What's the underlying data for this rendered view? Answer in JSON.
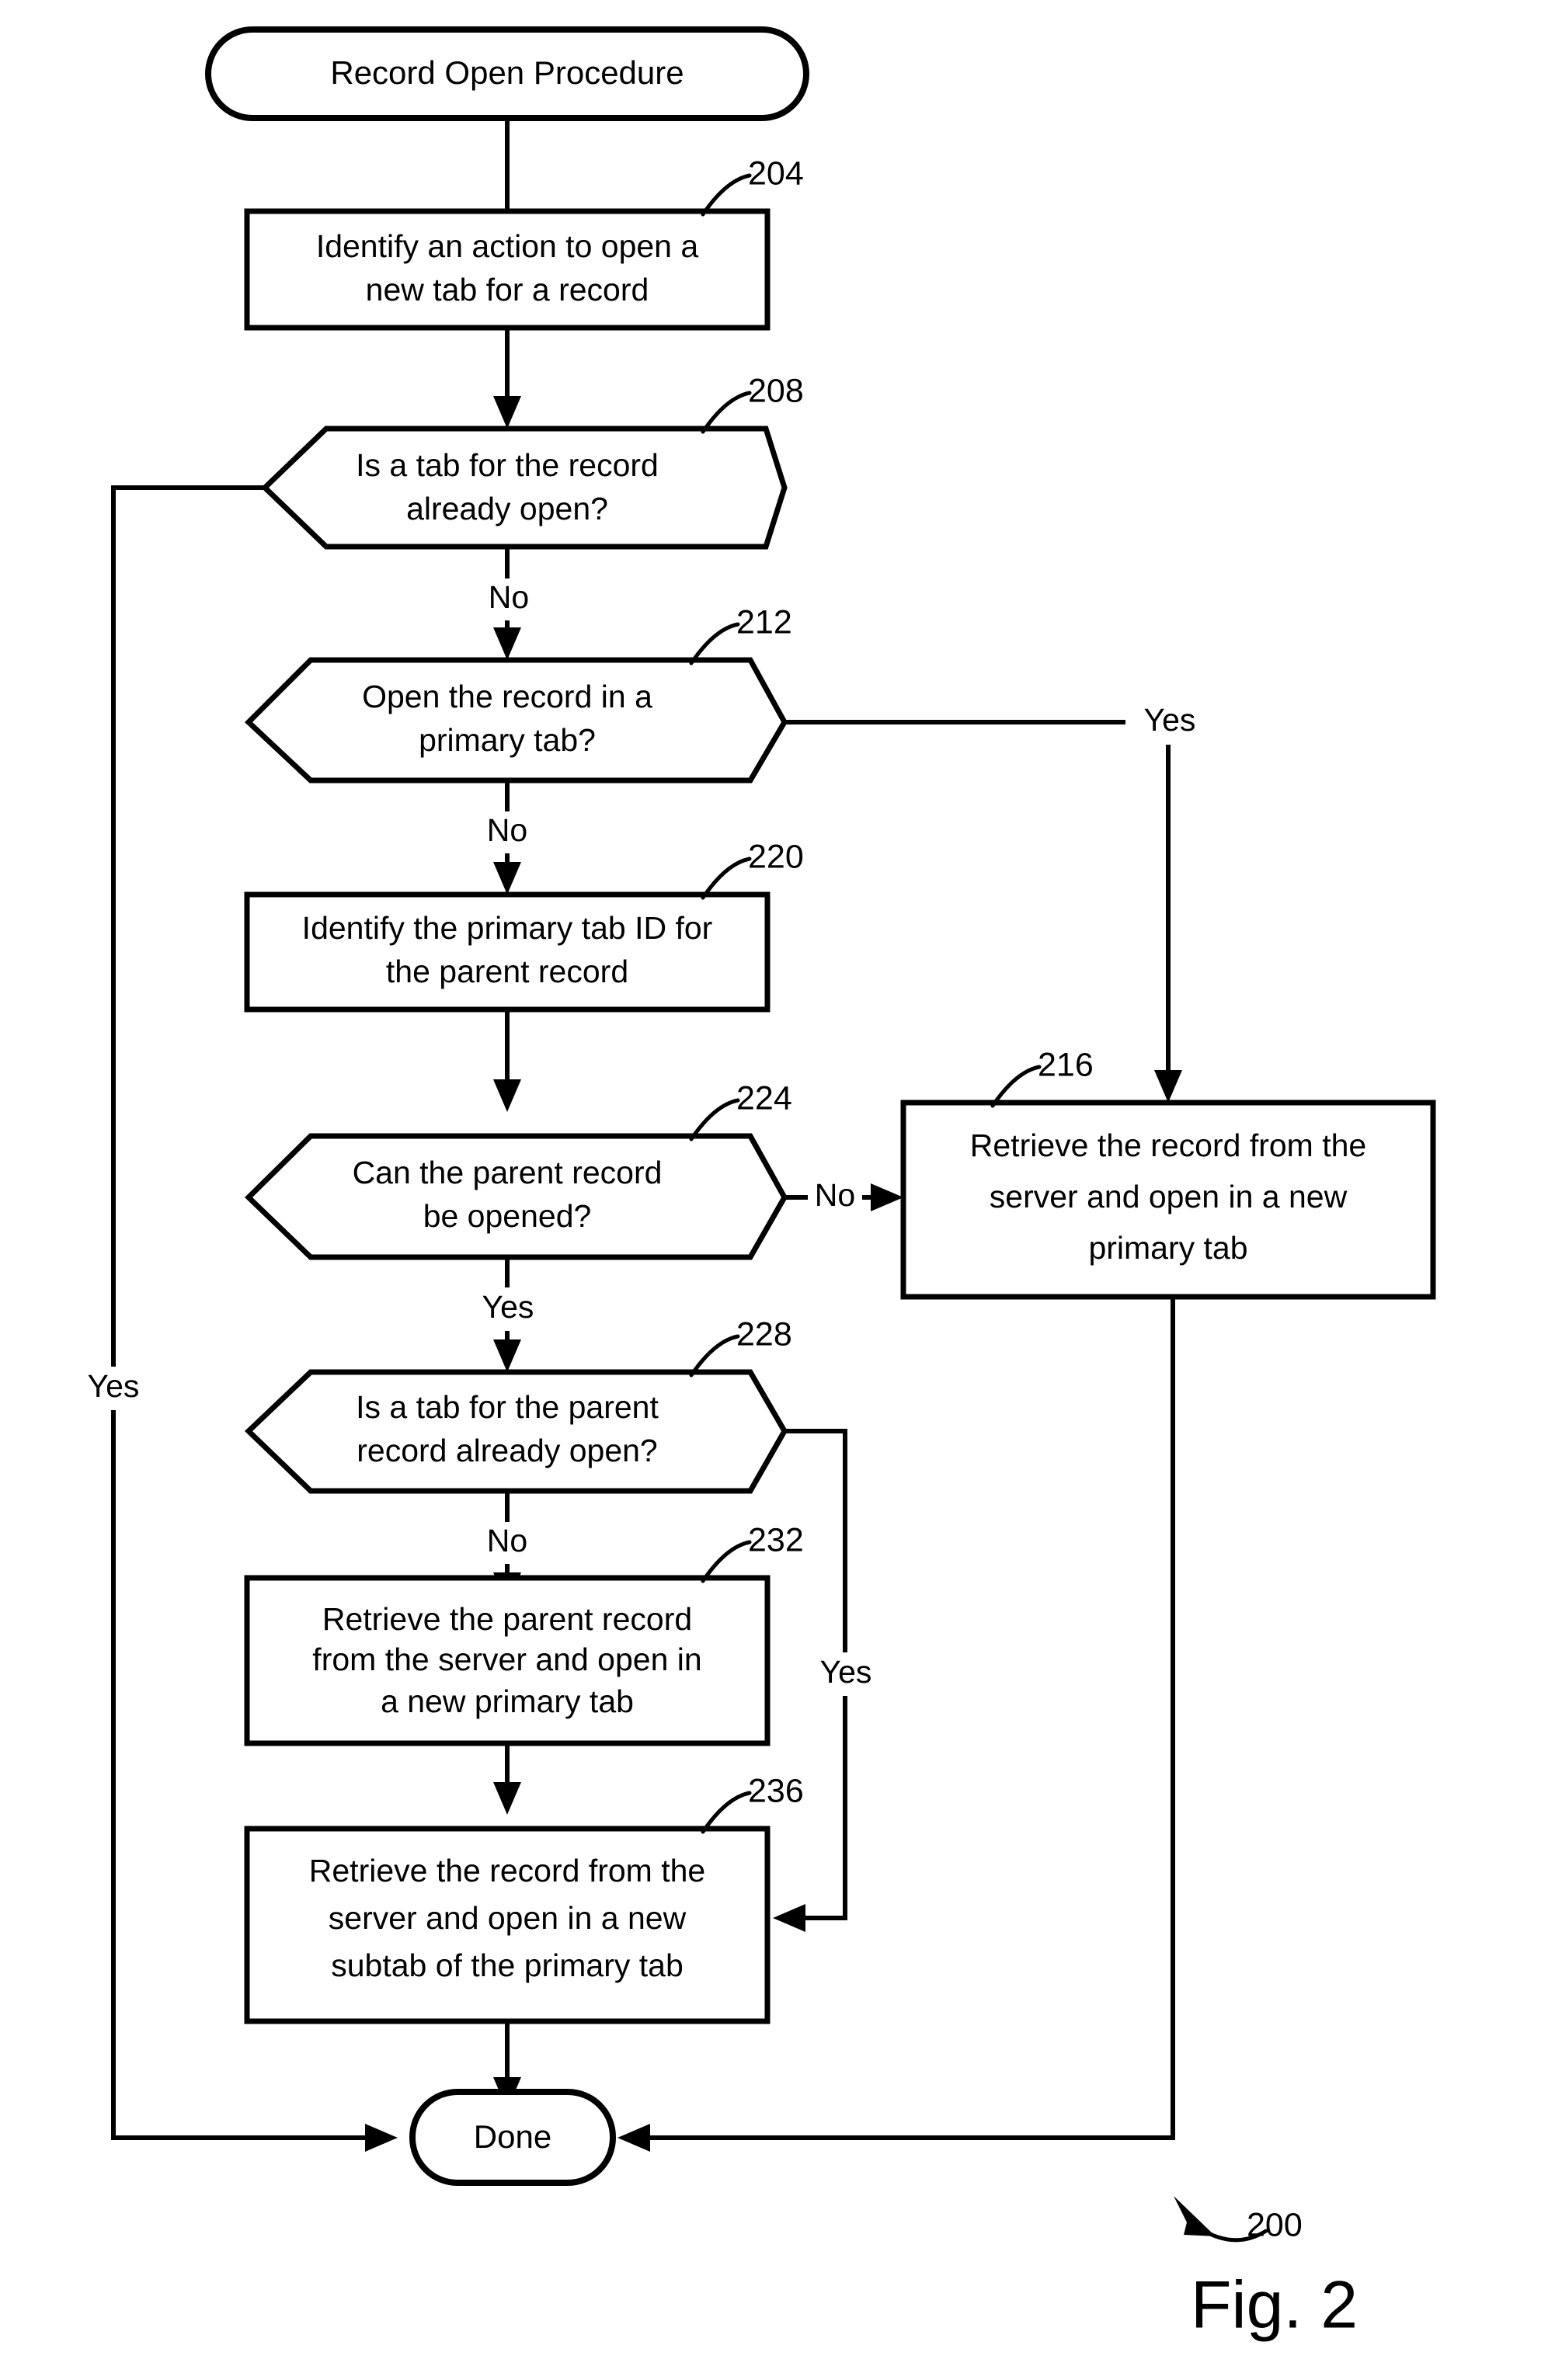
{
  "figure": {
    "caption": "Fig. 2",
    "overall_ref": "200",
    "title": "Record Open Procedure flowchart"
  },
  "nodes": {
    "start": {
      "id": "start",
      "shape": "terminal",
      "label": "Record Open Procedure",
      "ref": ""
    },
    "n204": {
      "id": "204",
      "shape": "process",
      "ref": "204",
      "line1": "Identify an action to open a",
      "line2": "new tab for a record"
    },
    "n208": {
      "id": "208",
      "shape": "decision",
      "ref": "208",
      "line1": "Is a tab for the record",
      "line2": "already open?"
    },
    "n212": {
      "id": "212",
      "shape": "decision",
      "ref": "212",
      "line1": "Open the record in a",
      "line2": "primary tab?"
    },
    "n216": {
      "id": "216",
      "shape": "process",
      "ref": "216",
      "line1": "Retrieve the record from the",
      "line2": "server and open in a new",
      "line3": "primary tab"
    },
    "n220": {
      "id": "220",
      "shape": "process",
      "ref": "220",
      "line1": "Identify the primary tab ID for",
      "line2": "the parent record"
    },
    "n224": {
      "id": "224",
      "shape": "decision",
      "ref": "224",
      "line1": "Can the parent record",
      "line2": "be opened?"
    },
    "n228": {
      "id": "228",
      "shape": "decision",
      "ref": "228",
      "line1": "Is a tab for the parent",
      "line2": "record already open?"
    },
    "n232": {
      "id": "232",
      "shape": "process",
      "ref": "232",
      "line1": "Retrieve the parent record",
      "line2": "from the server and open in",
      "line3": "a new primary tab"
    },
    "n236": {
      "id": "236",
      "shape": "process",
      "ref": "236",
      "line1": "Retrieve the record from the",
      "line2": "server and open in a new",
      "line3": "subtab of the primary tab"
    },
    "done": {
      "id": "done",
      "shape": "terminal",
      "label": "Done",
      "ref": ""
    }
  },
  "edge_labels": {
    "e208_no": "No",
    "e208_yes": "Yes",
    "e212_no": "No",
    "e212_yes": "Yes",
    "e224_no": "No",
    "e224_yes": "Yes",
    "e228_no": "No",
    "e228_yes": "Yes"
  },
  "colors": {
    "stroke": "#000000",
    "fill": "#ffffff",
    "background": "#ffffff"
  }
}
